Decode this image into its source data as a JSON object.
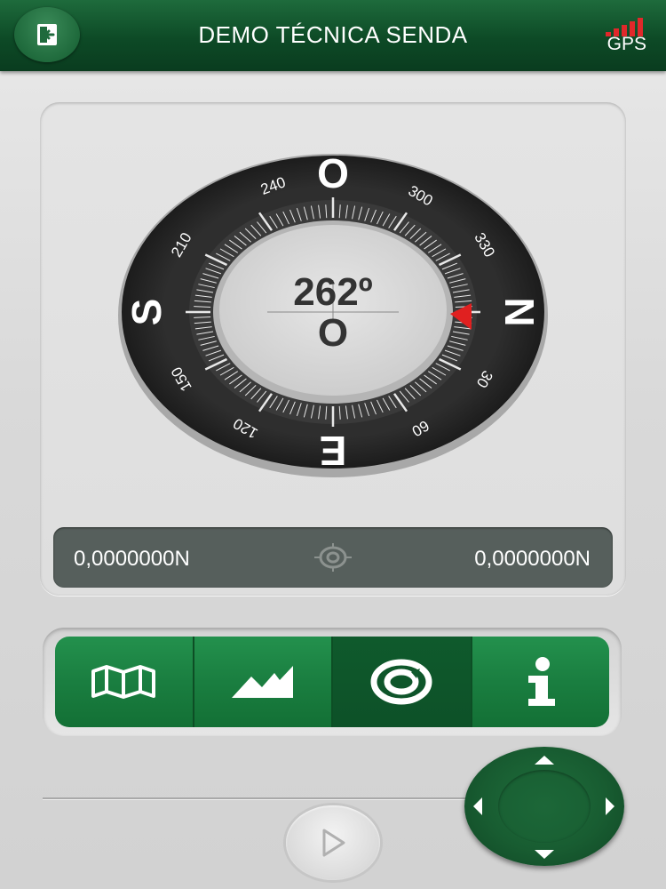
{
  "header": {
    "title": "DEMO TÉCNICA SENDA",
    "gps_label": "GPS",
    "gps_color": "#e0282a",
    "back_icon": "exit-icon"
  },
  "compass": {
    "heading_value": "262º",
    "heading_direction": "O",
    "cardinal_labels": [
      "O",
      "N",
      "E",
      "S"
    ],
    "degree_labels": [
      "240",
      "300",
      "330",
      "30",
      "60",
      "120",
      "150",
      "210"
    ],
    "needle_color": "#e02020"
  },
  "coordinates": {
    "latitude": "0,0000000N",
    "longitude": "0,0000000N",
    "center_icon": "crosshair-icon"
  },
  "nav": {
    "items": [
      {
        "icon": "map-icon",
        "active": false
      },
      {
        "icon": "terrain-icon",
        "active": false
      },
      {
        "icon": "compass-icon",
        "active": true
      },
      {
        "icon": "info-icon",
        "active": false
      }
    ]
  },
  "controls": {
    "play_icon": "play-icon",
    "dpad_icons": [
      "arrow-up-icon",
      "arrow-down-icon",
      "arrow-left-icon",
      "arrow-right-icon"
    ]
  },
  "theme": {
    "primary_green": "#1a7e40",
    "dark_green": "#0d4a26",
    "coord_bar": "#565f5c"
  }
}
